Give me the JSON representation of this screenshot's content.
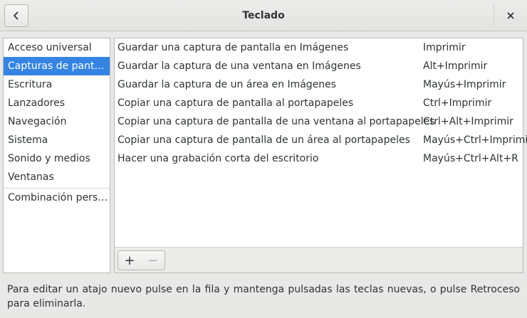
{
  "window": {
    "title": "Teclado"
  },
  "sidebar": {
    "items": [
      {
        "label": "Acceso universal",
        "selected": false
      },
      {
        "label": "Capturas de pantalla",
        "selected": true
      },
      {
        "label": "Escritura",
        "selected": false
      },
      {
        "label": "Lanzadores",
        "selected": false
      },
      {
        "label": "Navegación",
        "selected": false
      },
      {
        "label": "Sistema",
        "selected": false
      },
      {
        "label": "Sonido y medios",
        "selected": false
      },
      {
        "label": "Ventanas",
        "selected": false
      }
    ],
    "custom_item": "Combinación personalizada"
  },
  "shortcuts": [
    {
      "action": "Guardar una captura de pantalla en Imágenes",
      "keys": "Imprimir"
    },
    {
      "action": "Guardar la captura de una ventana en Imágenes",
      "keys": "Alt+Imprimir"
    },
    {
      "action": "Guardar la captura de un área en Imágenes",
      "keys": "Mayús+Imprimir"
    },
    {
      "action": "Copiar una captura de pantalla al portapapeles",
      "keys": "Ctrl+Imprimir"
    },
    {
      "action": "Copiar una captura de pantalla de una ventana al portapapeles",
      "keys": "Ctrl+Alt+Imprimir"
    },
    {
      "action": "Copiar una captura de pantalla de un área al portapapeles",
      "keys": "Mayús+Ctrl+Imprimir"
    },
    {
      "action": "Hacer una grabación corta del escritorio",
      "keys": "Mayús+Ctrl+Alt+R"
    }
  ],
  "toolbar": {
    "add_label": "+",
    "remove_label": "−"
  },
  "hint": "Para editar un atajo nuevo pulse en la fila y mantenga pulsadas las teclas nuevas, o pulse Retroceso para eliminarla.",
  "colors": {
    "selection": "#3584e4"
  },
  "icons": {
    "back": "chevron-left-icon",
    "close": "close-icon"
  }
}
